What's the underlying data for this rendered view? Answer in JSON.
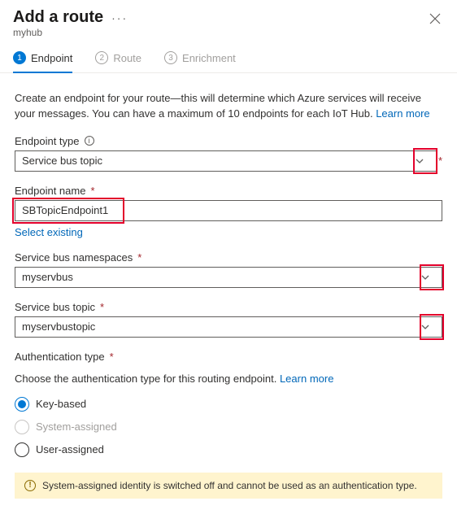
{
  "header": {
    "title": "Add a route",
    "subtitle": "myhub"
  },
  "steps": [
    {
      "num": "1",
      "label": "Endpoint",
      "active": true
    },
    {
      "num": "2",
      "label": "Route",
      "active": false
    },
    {
      "num": "3",
      "label": "Enrichment",
      "active": false
    }
  ],
  "intro": {
    "text": "Create an endpoint for your route—this will determine which Azure services will receive your messages. You can have a maximum of 10 endpoints for each IoT Hub. ",
    "link": "Learn more"
  },
  "fields": {
    "endpoint_type": {
      "label": "Endpoint type",
      "value": "Service bus topic"
    },
    "endpoint_name": {
      "label": "Endpoint name",
      "value": "SBTopicEndpoint1",
      "select_existing": "Select existing"
    },
    "namespace": {
      "label": "Service bus namespaces",
      "value": "myservbus"
    },
    "topic": {
      "label": "Service bus topic",
      "value": "myservbustopic"
    },
    "auth": {
      "label": "Authentication type",
      "desc": "Choose the authentication type for this routing endpoint. ",
      "desc_link": "Learn more",
      "options": [
        {
          "label": "Key-based",
          "state": "selected"
        },
        {
          "label": "System-assigned",
          "state": "disabled"
        },
        {
          "label": "User-assigned",
          "state": "normal"
        }
      ]
    }
  },
  "warning": "System-assigned identity is switched off and cannot be used as an authentication type."
}
